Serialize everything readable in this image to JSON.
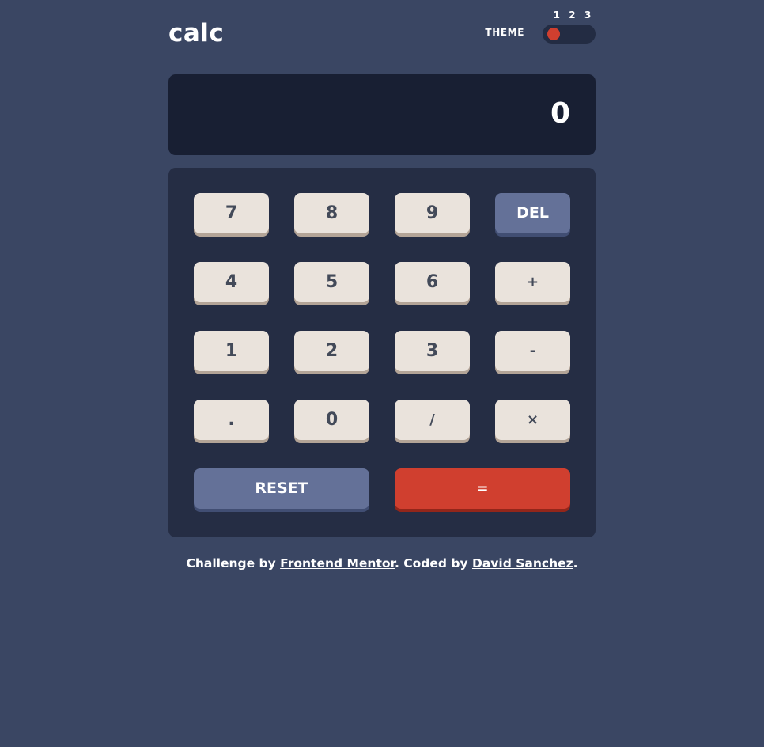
{
  "header": {
    "logo": "calc",
    "theme_label": "THEME",
    "theme_options": [
      "1",
      "2",
      "3"
    ],
    "selected_theme": "1"
  },
  "display": {
    "value": "0"
  },
  "keypad": {
    "keys": {
      "seven": "7",
      "eight": "8",
      "nine": "9",
      "del": "DEL",
      "four": "4",
      "five": "5",
      "six": "6",
      "plus": "+",
      "one": "1",
      "two": "2",
      "three": "3",
      "minus": "-",
      "decimal": ".",
      "zero": "0",
      "divide": "/",
      "multiply": "×",
      "reset": "RESET",
      "equals": "="
    }
  },
  "footer": {
    "prefix": "Challenge by ",
    "link1": "Frontend Mentor",
    "middle": ". Coded by ",
    "link2": "David Sanchez",
    "suffix": "."
  },
  "colors": {
    "background": "#3a4663",
    "display_bg": "#181f33",
    "keypad_bg": "#252d44",
    "key_bg": "#eae3dc",
    "key_shadow": "#b3a497",
    "key_text": "#434a59",
    "secondary_key_bg": "#647198",
    "secondary_key_shadow": "#414e73",
    "accent": "#d03f2f",
    "accent_shadow": "#93261a"
  }
}
